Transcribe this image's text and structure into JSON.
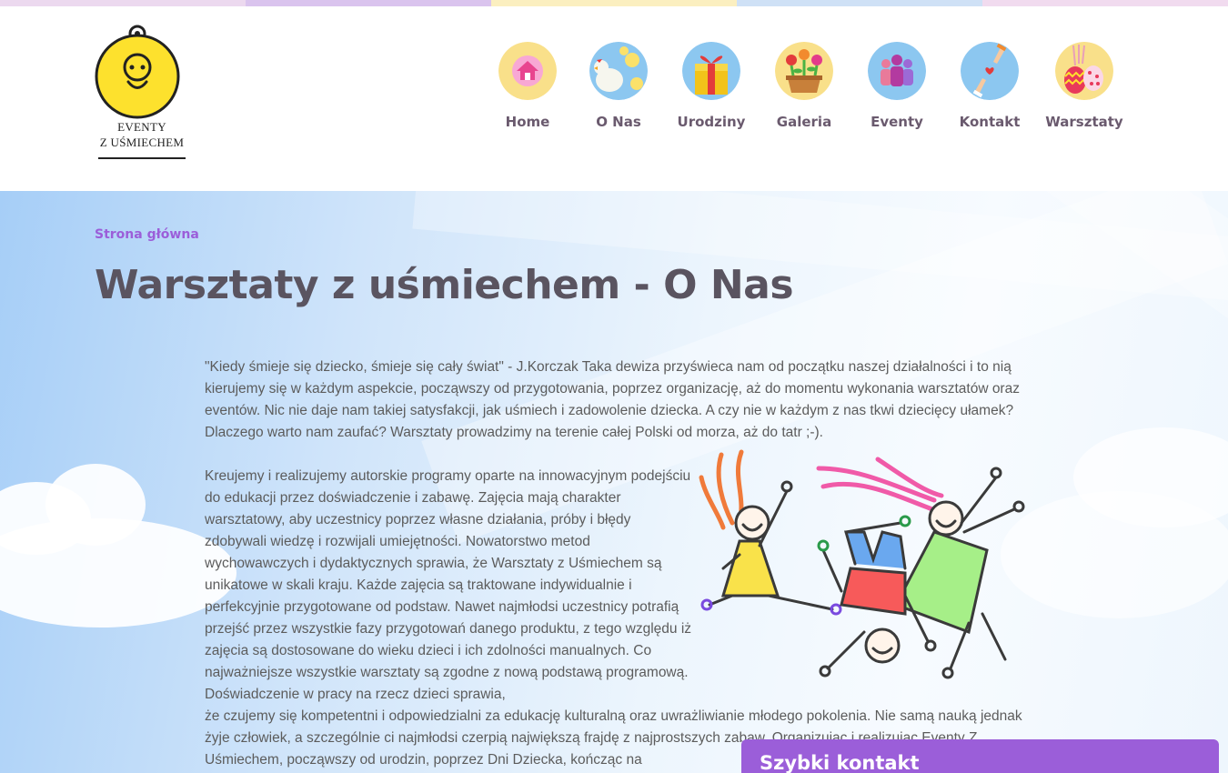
{
  "colors": {
    "accent": "#9b5ed9",
    "title": "#5a5460",
    "text": "#5c5c5c",
    "nav_label": "#6a5a6e",
    "stripes": [
      "#e8d4ee",
      "#d7c1ed",
      "#fbf0c2",
      "#cfe1f6",
      "#f0d9ee"
    ]
  },
  "logo": {
    "line1": "EVENTY",
    "line2": "Z UŚMIECHEM"
  },
  "nav": {
    "items": [
      {
        "label": "Home",
        "icon": "house-icon"
      },
      {
        "label": "O Nas",
        "icon": "chickens-icon"
      },
      {
        "label": "Urodziny",
        "icon": "gift-icon"
      },
      {
        "label": "Galeria",
        "icon": "flower-pot-icon"
      },
      {
        "label": "Eventy",
        "icon": "people-icon"
      },
      {
        "label": "Kontakt",
        "icon": "hands-heart-icon"
      },
      {
        "label": "Warsztaty",
        "icon": "easter-eggs-icon"
      }
    ]
  },
  "breadcrumb": "Strona główna",
  "page_title": "Warsztaty z uśmiechem - O Nas",
  "content": {
    "para1": "\"Kiedy śmieje się dziecko, śmieje się cały świat\" - J.Korczak Taka dewiza przyświeca nam od początku naszej działalności i to nią kierujemy się w każdym aspekcie, począwszy od przygotowania, poprzez organizację, aż do momentu wykonania warsztatów oraz eventów. Nic nie daje nam takiej satysfakcji, jak uśmiech i zadowolenie dziecka. A czy nie w każdym z nas tkwi dziecięcy ułamek? Dlaczego warto nam zaufać? Warsztaty prowadzimy na terenie całej Polski od morza, aż do tatr ;-).",
    "para2_narrow": "Kreujemy i realizujemy autorskie programy oparte na innowacyjnym podejściu do edukacji przez doświadczenie i zabawę. Zajęcia mają charakter warsztatowy, aby uczestnicy poprzez własne działania, próby i błędy zdobywali wiedzę i rozwijali umiejętności. Nowatorstwo metod wychowawczych i dydaktycznych sprawia, że Warsztaty z Uśmiechem są unikatowe w skali kraju. Każde zajęcia są traktowane indywidualnie i perfekcyjnie przygotowane od podstaw. Nawet najmłodsi uczestnicy potrafią przejść przez wszystkie fazy przygotowań danego produktu, z tego względu iż zajęcia są dostosowane do wieku dzieci i ich zdolności manualnych. Co najważniejsze wszystkie warsztaty są zgodne z nową podstawą programową. Doświadczenie w pracy na rzecz dzieci sprawia,",
    "para2_wide": "że czujemy się kompetentni i odpowiedzialni za edukację kulturalną oraz uwrażliwianie młodego pokolenia. Nie samą nauką jednak żyje człowiek, a szczególnie ci najmłodsi czerpią największą frajdę z najprostszych zabaw. Organizując i realizując Eventy Z Uśmiechem, począwszy od urodzin, poprzez Dni Dziecka, kończąc na"
  },
  "quick_contact": {
    "label": "Szybki kontakt"
  }
}
